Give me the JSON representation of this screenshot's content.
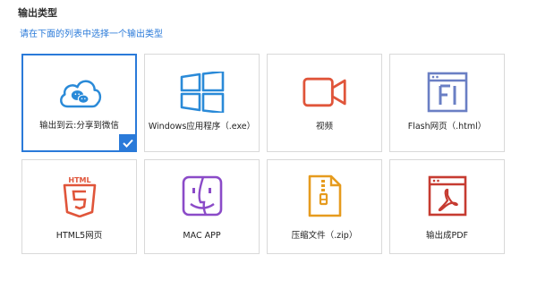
{
  "header": {
    "title": "输出类型",
    "subtitle": "请在下面的列表中选择一个输出类型"
  },
  "options": [
    {
      "label": "输出到云:分享到微信",
      "icon": "cloud-wechat-icon",
      "color": "#2a8ad8",
      "selected": true
    },
    {
      "label": "Windows应用程序（.exe）",
      "icon": "windows-icon",
      "color": "#2a8ad8",
      "selected": false
    },
    {
      "label": "视频",
      "icon": "video-camera-icon",
      "color": "#e0553a",
      "selected": false
    },
    {
      "label": "Flash网页（.html）",
      "icon": "flash-page-icon",
      "color": "#6a7fc4",
      "selected": false
    },
    {
      "label": "HTML5网页",
      "icon": "html5-icon",
      "color": "#e0553a",
      "selected": false
    },
    {
      "label": "MAC APP",
      "icon": "mac-finder-icon",
      "color": "#8b4bc8",
      "selected": false
    },
    {
      "label": "压缩文件（.zip）",
      "icon": "zip-file-icon",
      "color": "#e69b1e",
      "selected": false
    },
    {
      "label": "输出成PDF",
      "icon": "pdf-file-icon",
      "color": "#c63b31",
      "selected": false
    }
  ],
  "colors": {
    "accent": "#2a7ad9"
  }
}
